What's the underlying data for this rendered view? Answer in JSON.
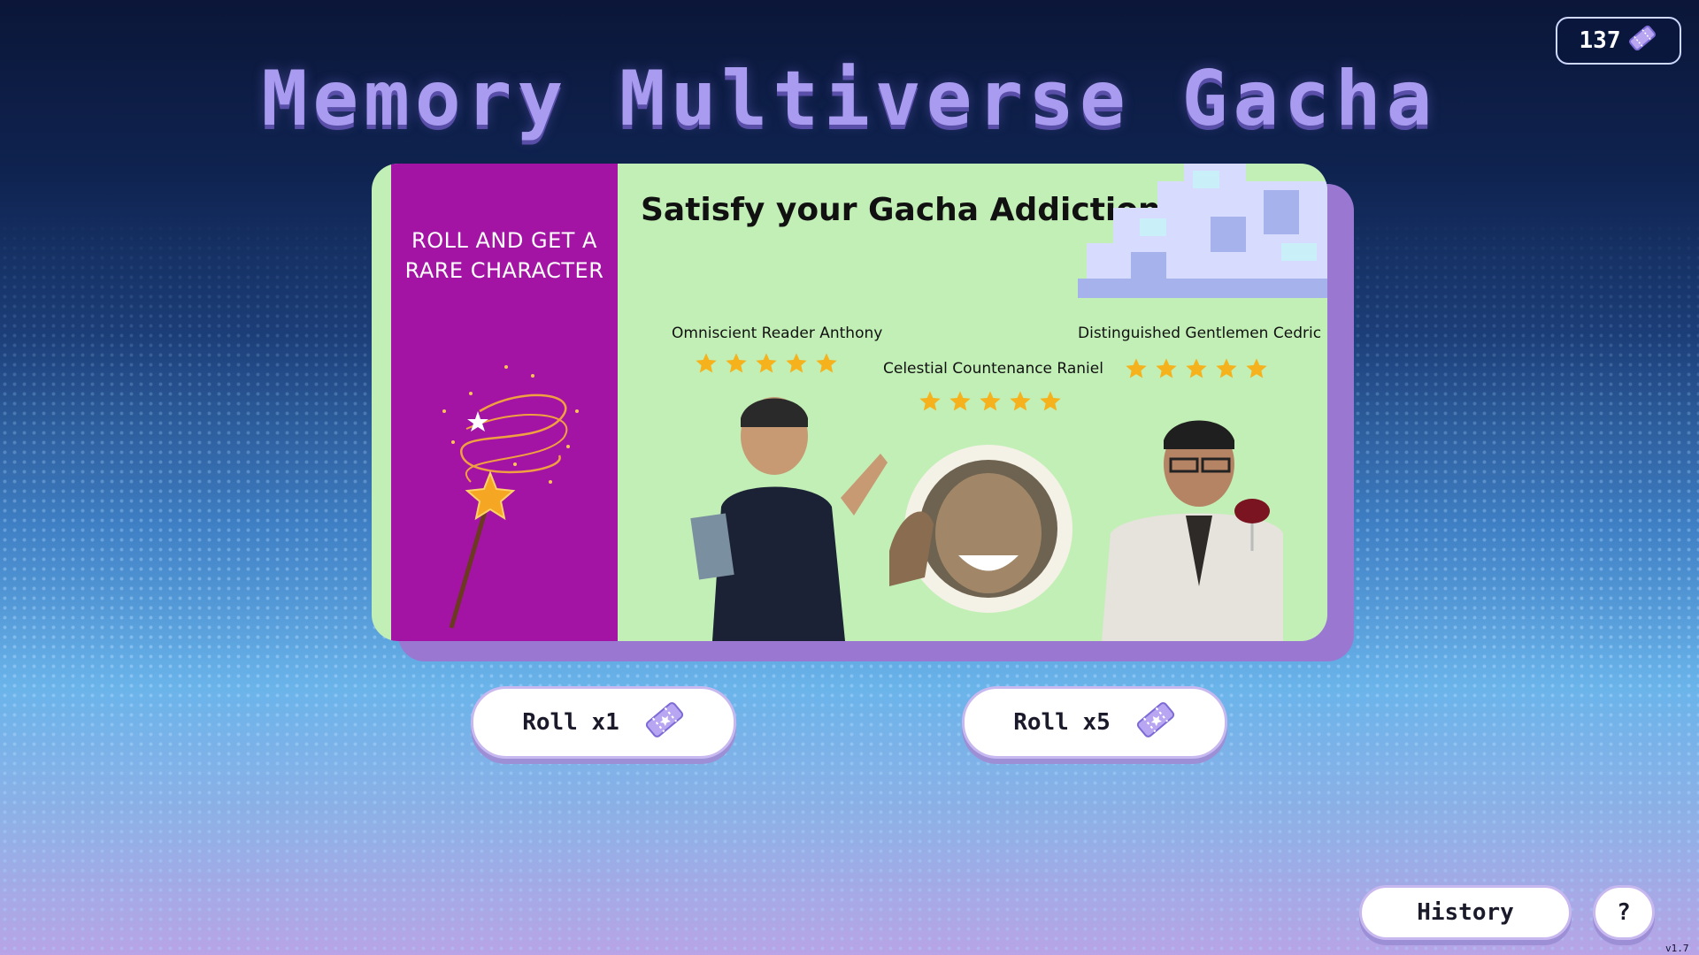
{
  "header": {
    "title": "Memory Multiverse Gacha",
    "ticket_count": "137",
    "ticket_icon": "ticket-icon"
  },
  "banner": {
    "side_text_line1": "ROLL AND GET A",
    "side_text_line2": "RARE CHARACTER",
    "headline": "Satisfy your Gacha Addiction!",
    "characters": [
      {
        "name": "Omniscient Reader Anthony",
        "stars": 5
      },
      {
        "name": "Celestial Countenance Raniel",
        "stars": 5
      },
      {
        "name": "Distinguished Gentlemen Cedric",
        "stars": 5
      }
    ]
  },
  "actions": {
    "roll_one": "Roll x1",
    "roll_five": "Roll x5",
    "history": "History",
    "help": "?"
  },
  "footer": {
    "version": "v1.7"
  },
  "colors": {
    "side_panel": "#a414a4",
    "banner_bg": "#c2efb6",
    "star": "#f5b21c",
    "title": "#a99cf0"
  }
}
